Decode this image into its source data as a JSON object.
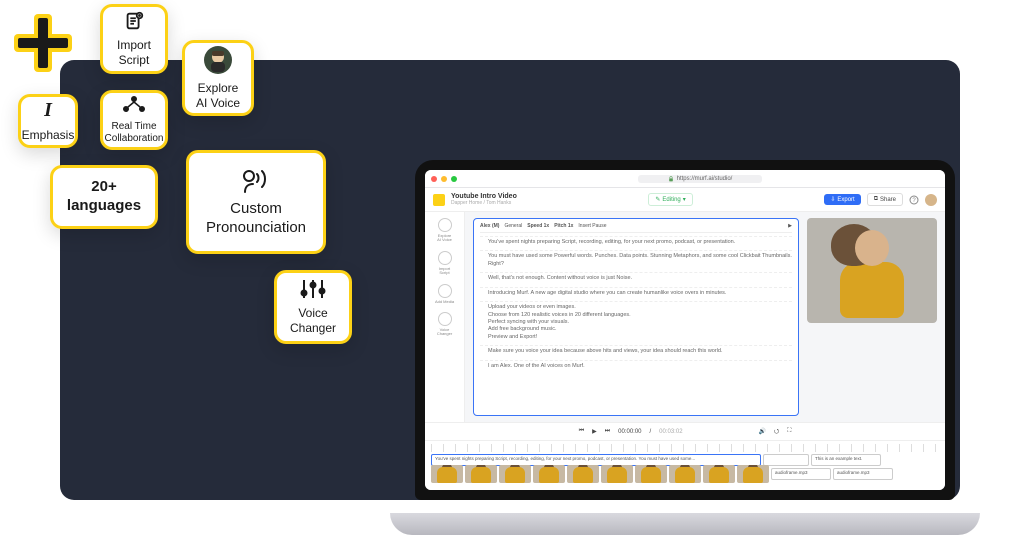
{
  "features": {
    "import_script": "Import\nScript",
    "explore_ai_voice": "Explore\nAI Voice",
    "emphasis": "Emphasis",
    "collab": "Real Time\nCollaboration",
    "languages": "20+\nlanguages",
    "custom_pron": "Custom\nPronounciation",
    "voice_changer": "Voice\nChanger"
  },
  "browser": {
    "url": "https://murf.ai/studio/"
  },
  "app": {
    "title": "Youtube Intro Video",
    "subtitle": "Dapper Home / Tom Hanks",
    "editing": "Editing",
    "export": "Export",
    "share": "Share"
  },
  "sidebar": [
    "Explore\nAI Voice",
    "Import\nScript",
    "Add Media",
    "Voice\nChanger"
  ],
  "toolbar": {
    "voice": "Alex (M)",
    "general": "General",
    "speed": "Speed 1x",
    "pitch": "Pitch 1x",
    "pause": "Insert Pause"
  },
  "script": [
    "You've spent nights preparing Script, recording, editing, for your next promo, podcast, or presentation.",
    "You must have used some Powerful words. Punches. Data points. Stunning Metaphors, and some cool Clickbait Thumbnails. Right?",
    "Well, that's not enough. Content without voice is just Noise.",
    "Introducing Murf. A new age digital studio where you can create humanlike voice overs in minutes.",
    "Upload your videos or even images.\nChoose from 120 realistic voices in 20 different languages.\nPerfect syncing with your visuals.\nAdd free background music.\nPreview and Export!",
    "Make sure you voice your idea because above hits and views, your idea should reach this world.",
    "I am Alex. One of the AI voices on Murf."
  ],
  "transport": {
    "cur": "00:00:00",
    "total": "00:03:02"
  },
  "timeline": {
    "clip1": "You've spent nights preparing Script, recording, editing, for your next promo, podcast, or presentation.  You must have used some...",
    "clip2": "This is an example text.",
    "audio_a": "audioframe.mp3",
    "audio_b": "audioframe.mp3"
  }
}
